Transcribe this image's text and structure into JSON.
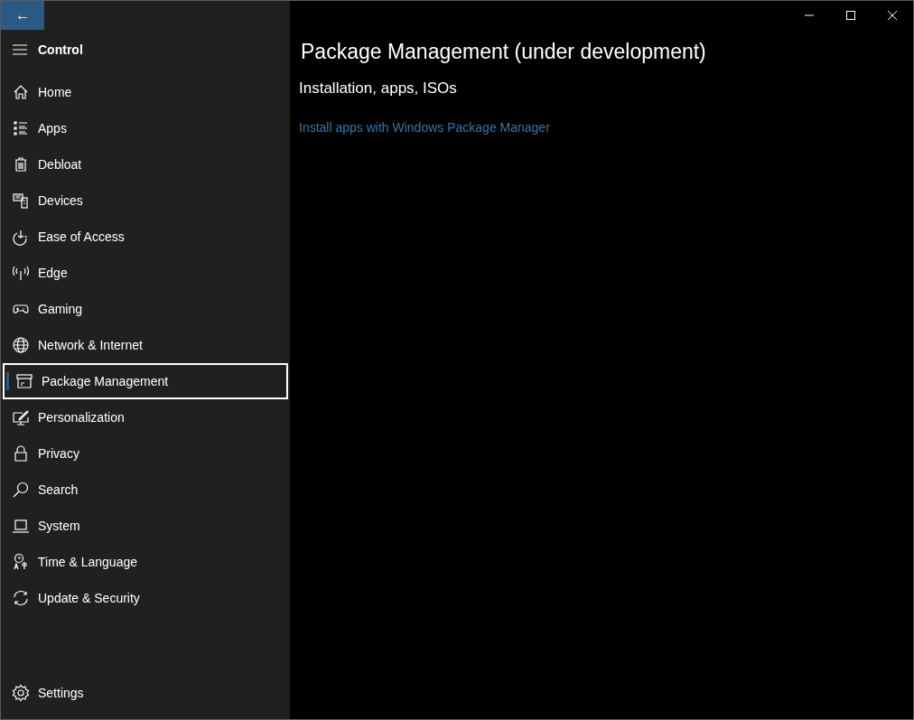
{
  "window": {
    "back_button": {
      "glyph": "←"
    },
    "caption_buttons": [
      {
        "kind": "minimize"
      },
      {
        "kind": "maximize"
      },
      {
        "kind": "close"
      }
    ]
  },
  "sidebar": {
    "title": "Control",
    "items": [
      {
        "label": "Home",
        "kind": "home",
        "selected": false
      },
      {
        "label": "Apps",
        "kind": "apps",
        "selected": false
      },
      {
        "label": "Debloat",
        "kind": "trash",
        "selected": false
      },
      {
        "label": "Devices",
        "kind": "devices",
        "selected": false
      },
      {
        "label": "Ease of Access",
        "kind": "access",
        "selected": false
      },
      {
        "label": "Edge",
        "kind": "antenna",
        "selected": false
      },
      {
        "label": "Gaming",
        "kind": "gamepad",
        "selected": false
      },
      {
        "label": "Network & Internet",
        "kind": "globe",
        "selected": false
      },
      {
        "label": "Package Management",
        "kind": "package",
        "selected": true
      },
      {
        "label": "Personalization",
        "kind": "paint",
        "selected": false
      },
      {
        "label": "Privacy",
        "kind": "lock",
        "selected": false
      },
      {
        "label": "Search",
        "kind": "search",
        "selected": false
      },
      {
        "label": "System",
        "kind": "laptop",
        "selected": false
      },
      {
        "label": "Time & Language",
        "kind": "time",
        "selected": false
      },
      {
        "label": "Update & Security",
        "kind": "sync",
        "selected": false
      }
    ],
    "footer_item": {
      "label": "Settings",
      "kind": "gear"
    }
  },
  "page": {
    "title": "Package Management (under development)",
    "subtitle": "Installation, apps, ISOs",
    "link": "Install apps with Windows Package Manager"
  }
}
